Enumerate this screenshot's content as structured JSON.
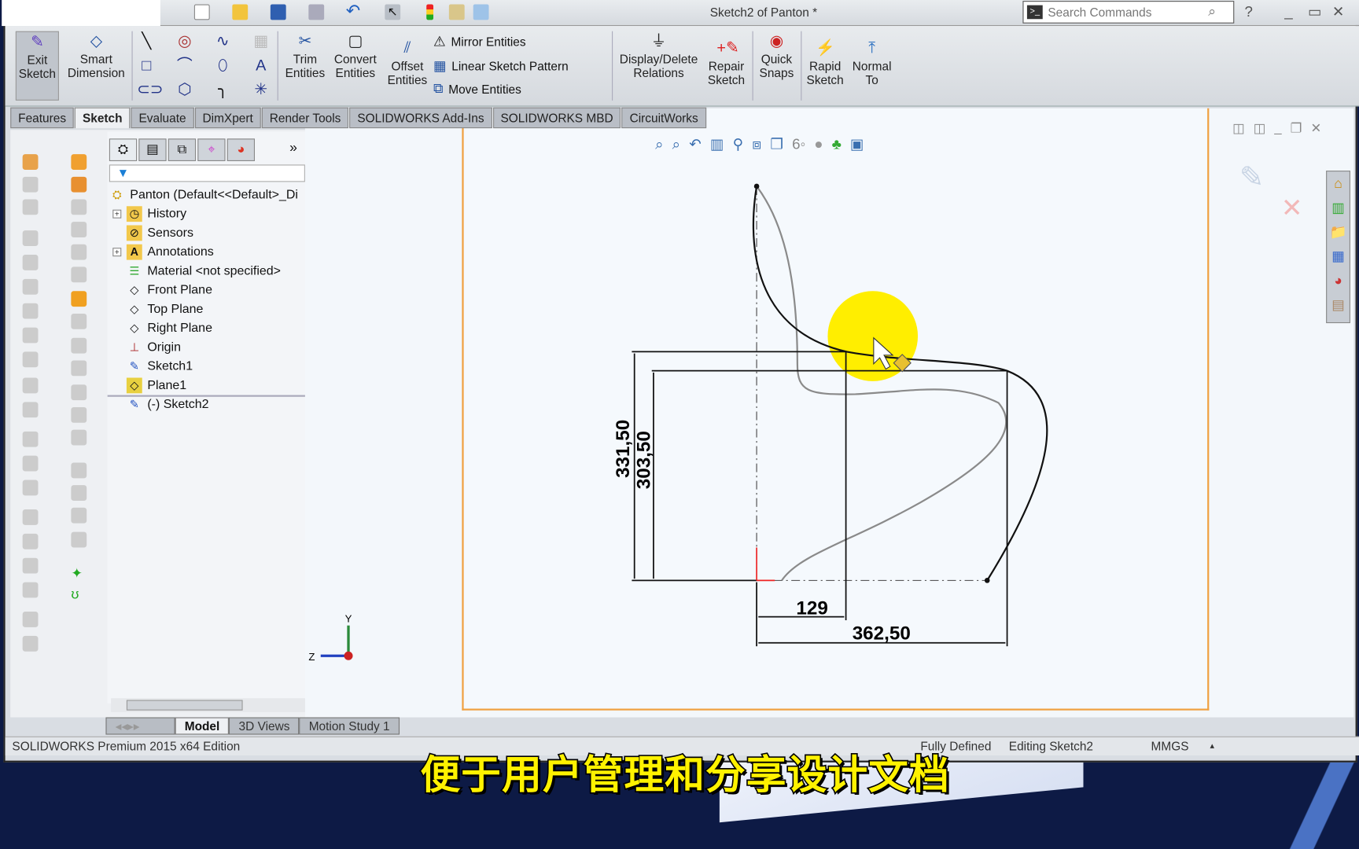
{
  "window": {
    "title": "Sketch2 of Panton *",
    "search_placeholder": "Search Commands"
  },
  "ribbon": {
    "exit_sketch": "Exit\nSketch",
    "smart_dimension": "Smart\nDimension",
    "trim": "Trim\nEntities",
    "convert": "Convert\nEntities",
    "offset": "Offset\nEntities",
    "mirror": "Mirror Entities",
    "linear_pattern": "Linear Sketch Pattern",
    "move": "Move Entities",
    "display_delete": "Display/Delete\nRelations",
    "repair": "Repair\nSketch",
    "quick_snaps": "Quick\nSnaps",
    "rapid_sketch": "Rapid\nSketch",
    "normal_to": "Normal\nTo"
  },
  "tabs": [
    "Features",
    "Sketch",
    "Evaluate",
    "DimXpert",
    "Render Tools",
    "SOLIDWORKS Add-Ins",
    "SOLIDWORKS MBD",
    "CircuitWorks"
  ],
  "active_tab": "Sketch",
  "tree": {
    "root": "Panton  (Default<<Default>_Di",
    "items": [
      "History",
      "Sensors",
      "Annotations",
      "Material <not specified>",
      "Front Plane",
      "Top Plane",
      "Right Plane",
      "Origin",
      "Sketch1",
      "Plane1",
      "(-) Sketch2"
    ]
  },
  "dimensions": {
    "height_outer": "331,50",
    "height_inner": "303,50",
    "width_small": "129",
    "width_large": "362,50"
  },
  "triad": {
    "y": "Y",
    "z": "Z"
  },
  "bottom_tabs": [
    "Model",
    "3D Views",
    "Motion Study 1"
  ],
  "status": {
    "edition": "SOLIDWORKS Premium 2015 x64 Edition",
    "state": "Fully Defined",
    "editing": "Editing Sketch2",
    "units": "MMGS"
  },
  "subtitle": "便于用户管理和分享设计文档",
  "colors": {
    "accent_border": "#f0a040",
    "cursor_highlight": "#ffee00",
    "subtitle": "#fff200"
  }
}
